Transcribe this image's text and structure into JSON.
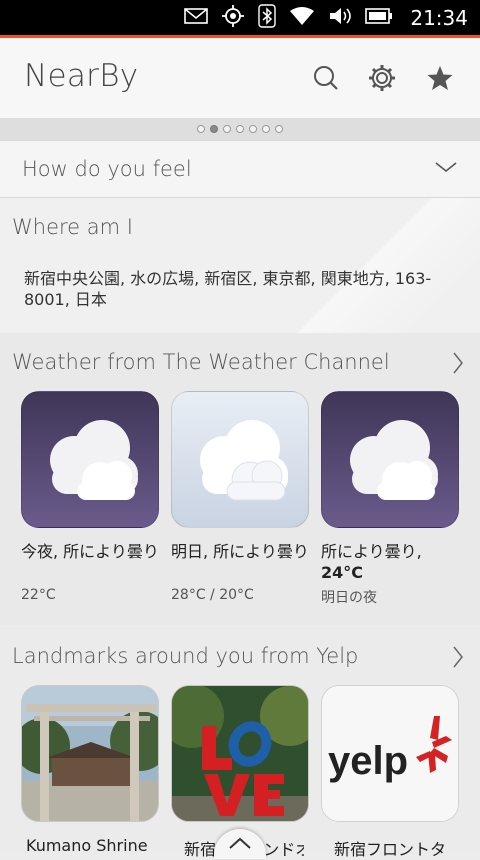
{
  "status": {
    "time": "21:34"
  },
  "app": {
    "title": "NearBy"
  },
  "header_icons": [
    "search-icon",
    "settings-icon",
    "favorite-star-icon"
  ],
  "pager": {
    "count": 7,
    "active": 1
  },
  "feel": {
    "label": "How do you feel"
  },
  "where": {
    "label": "Where am I",
    "address": "新宿中央公園, 水の広場, 新宿区, 東京都, 関東地方, 163-8001, 日本"
  },
  "weather": {
    "label": "Weather from The Weather Channel",
    "cards": [
      {
        "title": "今夜, 所により曇り",
        "temp": "22°C",
        "icon": "cloud-icon",
        "style": "purple"
      },
      {
        "title": "明日, 所により曇り",
        "temp": "28°C / 20°C",
        "icon": "cloud-icon",
        "style": "light"
      },
      {
        "title": "所により曇り,",
        "title_temp": "24°C",
        "temp": "明日の夜",
        "icon": "cloud-icon",
        "style": "purple"
      }
    ]
  },
  "landmarks": {
    "label": "Landmarks around you from Yelp",
    "items": [
      {
        "name": "Kumano Shrine"
      },
      {
        "name": "新宿アイランドオブ"
      },
      {
        "name": "新宿フロントタ"
      }
    ],
    "yelp_logo_text": "yelp"
  },
  "colors": {
    "accent": "#e95420",
    "tile_purple": "#5a4d7a"
  }
}
